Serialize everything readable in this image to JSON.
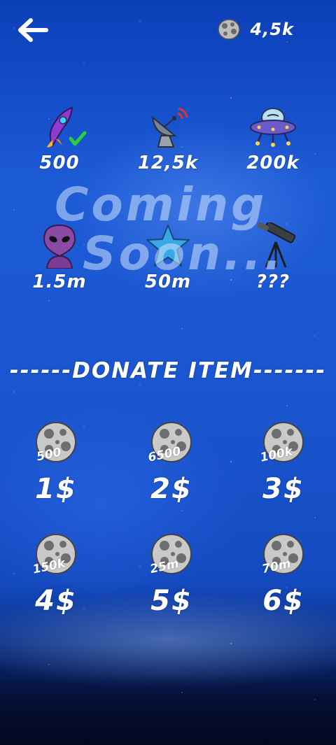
{
  "header": {
    "coin_count": "4,5k"
  },
  "achievements": [
    {
      "label": "500",
      "icon": "rocket-icon"
    },
    {
      "label": "12,5k",
      "icon": "satellite-dish-icon"
    },
    {
      "label": "200k",
      "icon": "ufo-icon"
    },
    {
      "label": "1.5m",
      "icon": "alien-icon"
    },
    {
      "label": "50m",
      "icon": "star-icon"
    },
    {
      "label": "???",
      "icon": "telescope-icon"
    }
  ],
  "coming_soon": {
    "line1": "Coming",
    "line2": "Soon..."
  },
  "donate": {
    "title": "------DONATE ITEM-------",
    "items": [
      {
        "amount": "500",
        "price": "1$"
      },
      {
        "amount": "6500",
        "price": "2$"
      },
      {
        "amount": "100k",
        "price": "3$"
      },
      {
        "amount": "150k",
        "price": "4$"
      },
      {
        "amount": "25m",
        "price": "5$"
      },
      {
        "amount": "70m",
        "price": "6$"
      }
    ]
  }
}
